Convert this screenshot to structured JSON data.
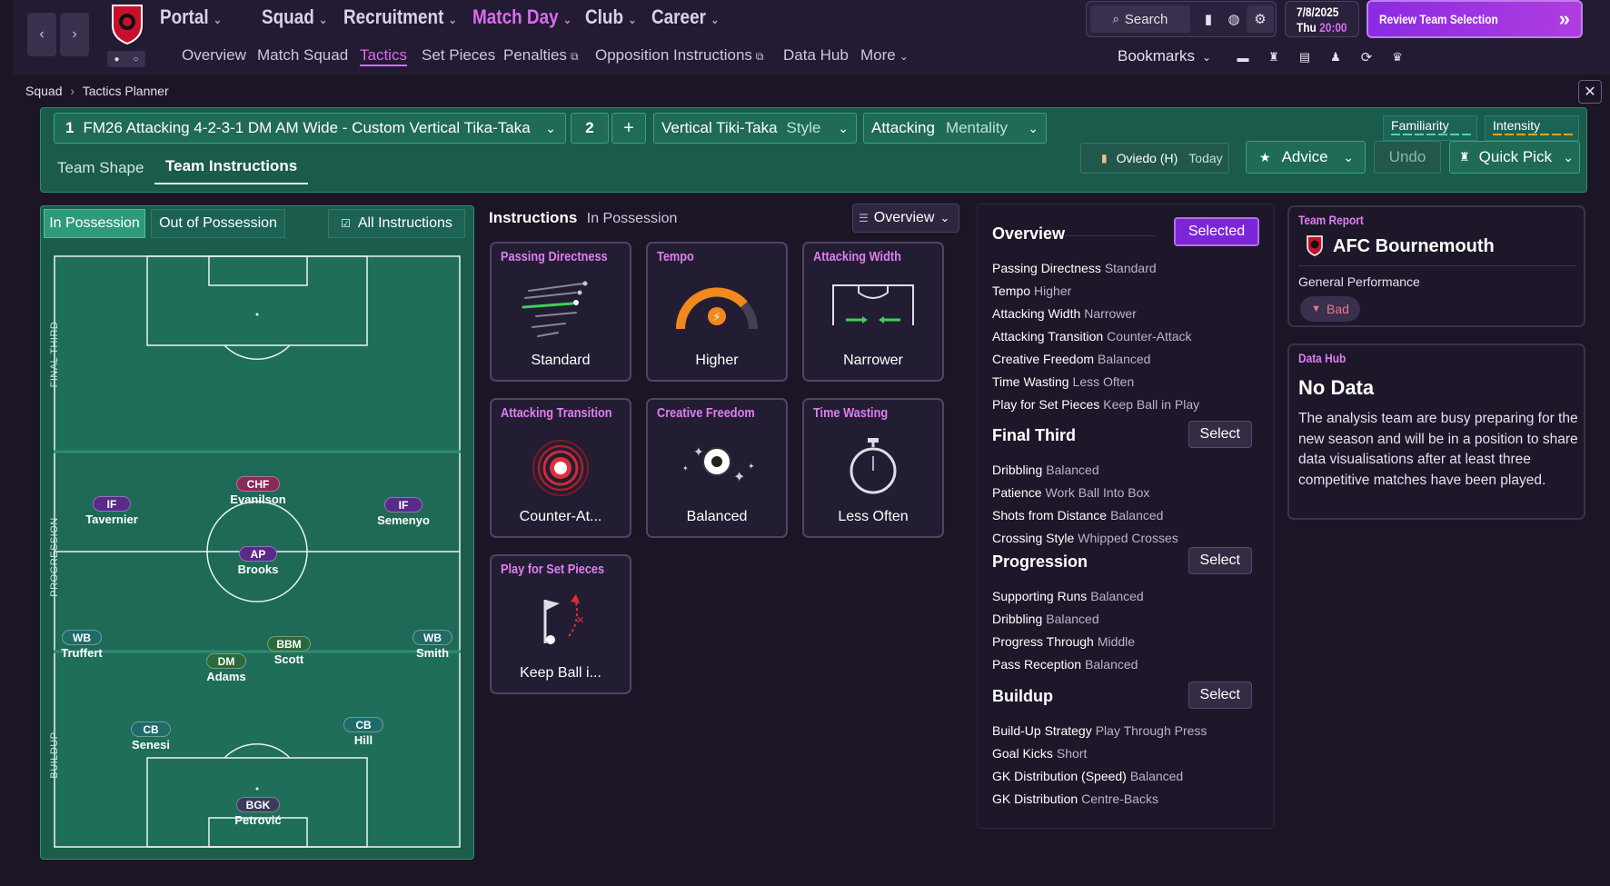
{
  "nav": {
    "back": "‹",
    "forward": "›",
    "main": [
      {
        "label": "Portal"
      },
      {
        "label": "Squad"
      },
      {
        "label": "Recruitment"
      },
      {
        "label": "Match Day"
      },
      {
        "label": "Club"
      },
      {
        "label": "Career"
      }
    ],
    "sub": [
      {
        "label": "Overview"
      },
      {
        "label": "Match Squad"
      },
      {
        "label": "Tactics"
      },
      {
        "label": "Set Pieces"
      },
      {
        "label": "Penalties"
      },
      {
        "label": "Opposition Instructions"
      },
      {
        "label": "Data Hub"
      },
      {
        "label": "More"
      }
    ],
    "search_label": "Search",
    "bookmarks_label": "Bookmarks",
    "date": "7/8/2025",
    "day": "Thu",
    "time": "20:00",
    "review_label": "Review Team Selection"
  },
  "breadcrumb": {
    "parent": "Squad",
    "current": "Tactics Planner"
  },
  "tactic": {
    "slot": "1",
    "name": "FM26 Attacking 4-2-3-1 DM AM Wide -  Custom Vertical Tika-Taka",
    "count": "2",
    "add": "+",
    "style_value": "Vertical Tiki-Taka",
    "style_label": "Style",
    "mentality_value": "Attacking",
    "mentality_label": "Mentality",
    "familiarity": "Familiarity",
    "intensity": "Intensity"
  },
  "tabs": {
    "shape": "Team Shape",
    "instructions": "Team Instructions"
  },
  "toolbar": {
    "fixture": "Oviedo (H)",
    "fixture_when": "Today",
    "advice": "Advice",
    "undo": "Undo",
    "quick_pick": "Quick Pick"
  },
  "phase": {
    "in": "In Possession",
    "out": "Out of Possession",
    "all": "All Instructions"
  },
  "zones": {
    "final": "FINAL THIRD",
    "progression": "PROGRESSION",
    "buildup": "BUILDUP"
  },
  "players": [
    {
      "role": "IF",
      "name": "Tavernier"
    },
    {
      "role": "CHF",
      "name": "Evanilson"
    },
    {
      "role": "IF",
      "name": "Semenyo"
    },
    {
      "role": "AP",
      "name": "Brooks"
    },
    {
      "role": "WB",
      "name": "Truffert"
    },
    {
      "role": "BBM",
      "name": "Scott"
    },
    {
      "role": "WB",
      "name": "Smith"
    },
    {
      "role": "DM",
      "name": "Adams"
    },
    {
      "role": "CB",
      "name": "Senesi"
    },
    {
      "role": "CB",
      "name": "Hill"
    },
    {
      "role": "BGK",
      "name": "Petrović"
    }
  ],
  "instructions": {
    "title": "Instructions",
    "subtitle": "In Possession",
    "view": "Overview",
    "cards": [
      {
        "title": "Passing Directness",
        "value": "Standard",
        "icon": "passing-directness-icon"
      },
      {
        "title": "Tempo",
        "value": "Higher",
        "icon": "tempo-gauge-icon"
      },
      {
        "title": "Attacking Width",
        "value": "Narrower",
        "icon": "attacking-width-icon"
      },
      {
        "title": "Attacking Transition",
        "value": "Counter-At...",
        "icon": "target-icon"
      },
      {
        "title": "Creative Freedom",
        "value": "Balanced",
        "icon": "ball-sparkle-icon"
      },
      {
        "title": "Time Wasting",
        "value": "Less Often",
        "icon": "stopwatch-icon"
      },
      {
        "title": "Play for Set Pieces",
        "value": "Keep Ball i...",
        "icon": "corner-flag-icon"
      }
    ]
  },
  "overview": {
    "title": "Overview",
    "selected": "Selected",
    "select": "Select",
    "general": [
      {
        "k": "Passing Directness",
        "v": "Standard"
      },
      {
        "k": "Tempo",
        "v": "Higher"
      },
      {
        "k": "Attacking Width",
        "v": "Narrower"
      },
      {
        "k": "Attacking Transition",
        "v": "Counter-Attack"
      },
      {
        "k": "Creative Freedom",
        "v": "Balanced"
      },
      {
        "k": "Time Wasting",
        "v": "Less Often"
      },
      {
        "k": "Play for Set Pieces",
        "v": "Keep Ball in Play"
      }
    ],
    "final_third": {
      "title": "Final Third",
      "rows": [
        {
          "k": "Dribbling",
          "v": "Balanced"
        },
        {
          "k": "Patience",
          "v": "Work Ball Into Box"
        },
        {
          "k": "Shots from Distance",
          "v": "Balanced"
        },
        {
          "k": "Crossing Style",
          "v": "Whipped Crosses"
        }
      ]
    },
    "progression": {
      "title": "Progression",
      "rows": [
        {
          "k": "Supporting Runs",
          "v": "Balanced"
        },
        {
          "k": "Dribbling",
          "v": "Balanced"
        },
        {
          "k": "Progress Through",
          "v": "Middle"
        },
        {
          "k": "Pass Reception",
          "v": "Balanced"
        }
      ]
    },
    "buildup": {
      "title": "Buildup",
      "rows": [
        {
          "k": "Build-Up Strategy",
          "v": "Play Through Press"
        },
        {
          "k": "Goal Kicks",
          "v": "Short"
        },
        {
          "k": "GK Distribution (Speed)",
          "v": "Balanced"
        },
        {
          "k": "GK Distribution",
          "v": "Centre-Backs"
        }
      ]
    }
  },
  "team_report": {
    "header": "Team Report",
    "club": "AFC Bournemouth",
    "label": "General Performance",
    "badge": "Bad"
  },
  "data_hub": {
    "header": "Data Hub",
    "title": "No Data",
    "body": "The analysis team are busy preparing for the new season and will be in a position to share data visualisations after at least three competitive matches have been played."
  },
  "colors": {
    "accent": "#d96cf0",
    "pitch": "#1b5c4b",
    "panel": "#1d1729",
    "review": "#8a2be2"
  }
}
